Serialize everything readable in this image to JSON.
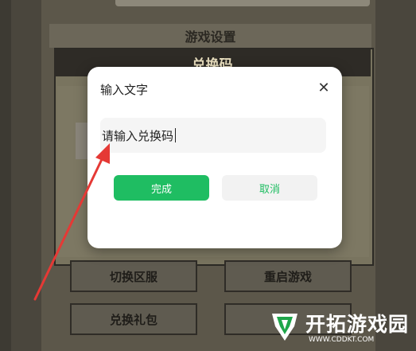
{
  "game": {
    "settings_header": "游戏设置",
    "redeem_title": "兑换码",
    "buttons": {
      "switch_server": "切换区服",
      "restart_game": "重启游戏",
      "redeem_gift": "兑换礼包"
    }
  },
  "dialog": {
    "title": "输入文字",
    "input_value": "请输入兑换码",
    "done_label": "完成",
    "cancel_label": "取消"
  },
  "watermark": {
    "brand": "开拓游戏园",
    "url": "WWW.CDDKT.COM"
  },
  "colors": {
    "accent": "#1fbd62",
    "arrow": "#e53935",
    "watermark_logo": "#1fa64a"
  }
}
